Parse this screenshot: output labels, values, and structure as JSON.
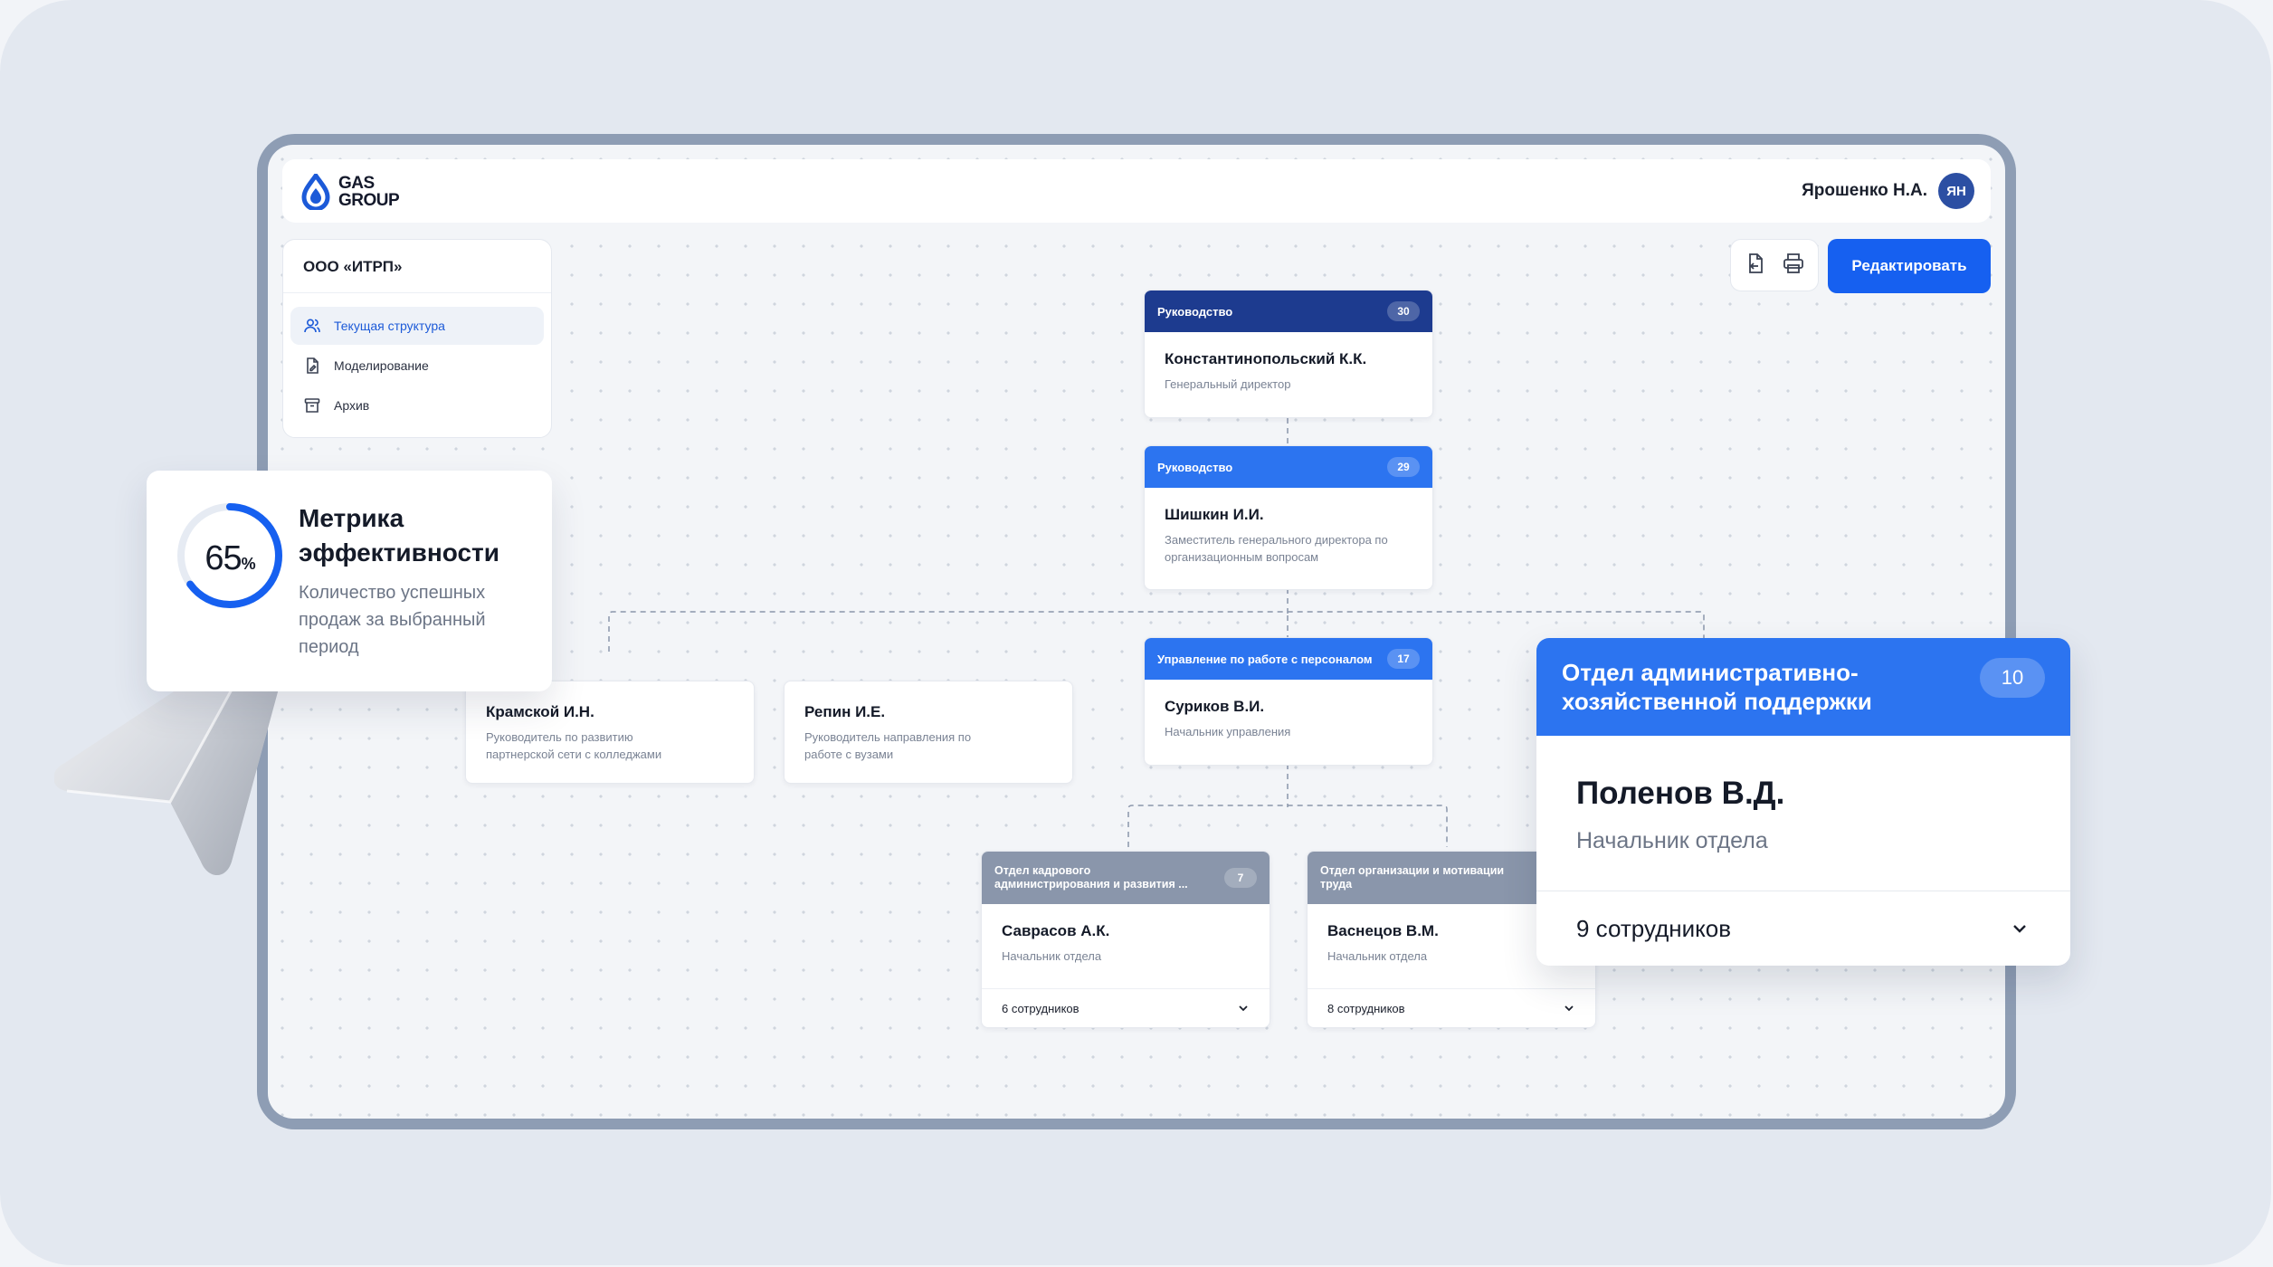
{
  "brand": {
    "name": "GAS GROUP",
    "line1": "GAS",
    "line2": "GROUP"
  },
  "user": {
    "name": "Ярошенко Н.А.",
    "initials": "ЯН"
  },
  "sidebar": {
    "company": "ООО «ИТРП»",
    "items": [
      {
        "label": "Текущая структура",
        "icon": "users-icon",
        "active": true
      },
      {
        "label": "Моделирование",
        "icon": "document-edit-icon",
        "active": false
      },
      {
        "label": "Архив",
        "icon": "archive-box-icon",
        "active": false
      }
    ]
  },
  "toolbar": {
    "export_icon": "document-export-icon",
    "print_icon": "printer-icon",
    "edit_label": "Редактировать"
  },
  "org": {
    "ceo": {
      "dept": "Руководство",
      "count": "30",
      "name": "Константинопольский К.К.",
      "role": "Генеральный директор"
    },
    "deputy": {
      "dept": "Руководство",
      "count": "29",
      "name": "Шишкин И.И.",
      "role": "Заместитель генерального директора по организационным вопросам"
    },
    "kramskoy": {
      "name": "Крамской И.Н.",
      "role": "Руководитель по развитию партнерской сети с колледжами"
    },
    "repin": {
      "name": "Репин И.Е.",
      "role": "Руководитель направления по работе с вузами"
    },
    "surikov": {
      "dept": "Управление по работе с персоналом",
      "count": "17",
      "name": "Суриков В.И.",
      "role": "Начальник управления"
    },
    "savrasov": {
      "dept": "Отдел кадрового администрирования и развития ...",
      "count": "7",
      "name": "Саврасов А.К.",
      "role": "Начальник отдела",
      "staff": "6 сотрудников"
    },
    "vasnetsov": {
      "dept": "Отдел организации и мотивации труда",
      "count": "",
      "name": "Васнецов В.М.",
      "role": "Начальник отдела",
      "staff": "8 сотрудников"
    },
    "polenov": {
      "dept": "Отдел административно-хозяйственной поддержки",
      "count": "10",
      "name": "Поленов В.Д.",
      "role": "Начальник отдела",
      "staff": "9 сотрудников"
    }
  },
  "metric": {
    "value": "65",
    "unit": "%",
    "progress": 0.65,
    "title": "Метрика эффективности",
    "description": "Количество успешных продаж за выбранный период"
  },
  "colors": {
    "accent": "#1660f0",
    "navy": "#1d3b8f",
    "blue": "#2c74f0",
    "gray_head": "#8a96ab"
  }
}
